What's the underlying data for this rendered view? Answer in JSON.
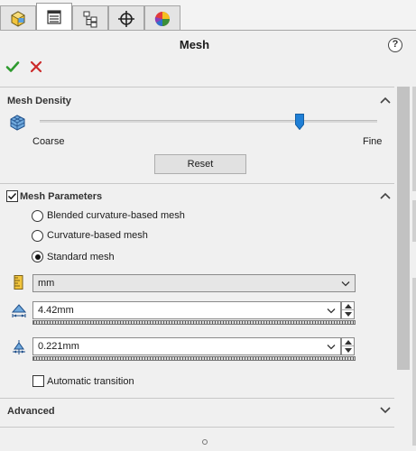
{
  "tabs": [
    {
      "icon": "part-icon",
      "active": false
    },
    {
      "icon": "property-manager-icon",
      "active": true
    },
    {
      "icon": "configuration-manager-icon",
      "active": false
    },
    {
      "icon": "dimxpert-icon",
      "active": false
    },
    {
      "icon": "display-manager-icon",
      "active": false
    }
  ],
  "header": {
    "title": "Mesh",
    "help": "?"
  },
  "mesh_density": {
    "title": "Mesh Density",
    "coarse_label": "Coarse",
    "fine_label": "Fine",
    "slider_value_fraction": 0.77,
    "reset_label": "Reset"
  },
  "mesh_parameters": {
    "title": "Mesh Parameters",
    "checked": true,
    "options": [
      {
        "label": "Blended curvature-based mesh",
        "selected": false
      },
      {
        "label": "Curvature-based mesh",
        "selected": false
      },
      {
        "label": "Standard mesh",
        "selected": true
      }
    ],
    "unit": "mm",
    "global_size": "4.42mm",
    "tolerance": "0.221mm",
    "auto_transition_label": "Automatic transition",
    "auto_transition_checked": false
  },
  "advanced": {
    "title": "Advanced"
  },
  "colors": {
    "accent": "#1f7fd6",
    "ok": "#2e9a2e",
    "cancel": "#cc2a2a"
  }
}
